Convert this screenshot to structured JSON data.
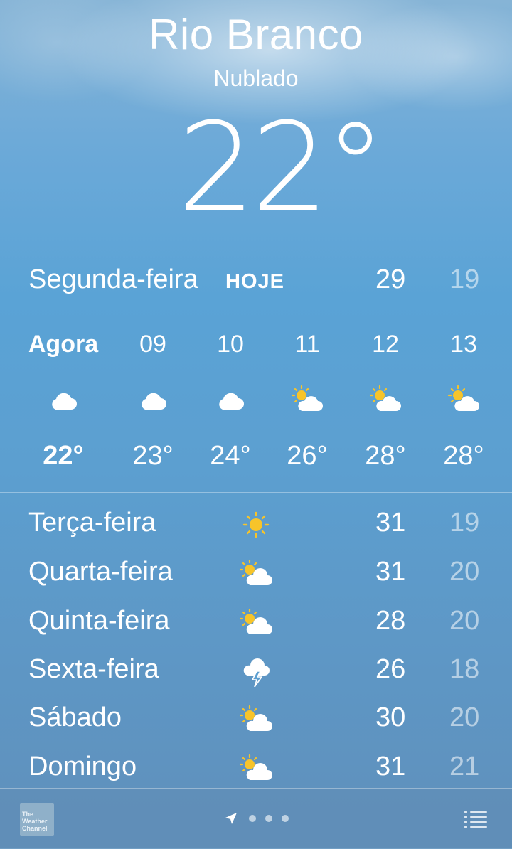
{
  "location": {
    "city": "Rio Branco",
    "condition": "Nublado",
    "temperature": "22°"
  },
  "today": {
    "day": "Segunda-feira",
    "tag": "HOJE",
    "high": "29",
    "low": "19"
  },
  "hourly": [
    {
      "label": "Agora",
      "icon": "cloud-icon",
      "temp": "22°"
    },
    {
      "label": "09",
      "icon": "cloud-icon",
      "temp": "23°"
    },
    {
      "label": "10",
      "icon": "cloud-icon",
      "temp": "24°"
    },
    {
      "label": "11",
      "icon": "partly-sunny-icon",
      "temp": "26°"
    },
    {
      "label": "12",
      "icon": "partly-sunny-icon",
      "temp": "28°"
    },
    {
      "label": "13",
      "icon": "partly-sunny-icon",
      "temp": "28°"
    }
  ],
  "daily": [
    {
      "day": "Terça-feira",
      "icon": "sun-icon",
      "high": "31",
      "low": "19"
    },
    {
      "day": "Quarta-feira",
      "icon": "partly-sunny-icon",
      "high": "31",
      "low": "20"
    },
    {
      "day": "Quinta-feira",
      "icon": "partly-sunny-icon",
      "high": "28",
      "low": "20"
    },
    {
      "day": "Sexta-feira",
      "icon": "thunderstorm-icon",
      "high": "26",
      "low": "18"
    },
    {
      "day": "Sábado",
      "icon": "partly-sunny-icon",
      "high": "30",
      "low": "20"
    },
    {
      "day": "Domingo",
      "icon": "partly-sunny-icon",
      "high": "31",
      "low": "21"
    }
  ],
  "footer": {
    "logo_text": [
      "The",
      "Weather",
      "Channel"
    ],
    "page_count": 3,
    "current_page": "location-arrow",
    "list_icon": "list-icon"
  },
  "colors": {
    "sun": "#f7c42a",
    "text": "#ffffff",
    "low_temp": "rgba(255,255,255,0.55)"
  }
}
